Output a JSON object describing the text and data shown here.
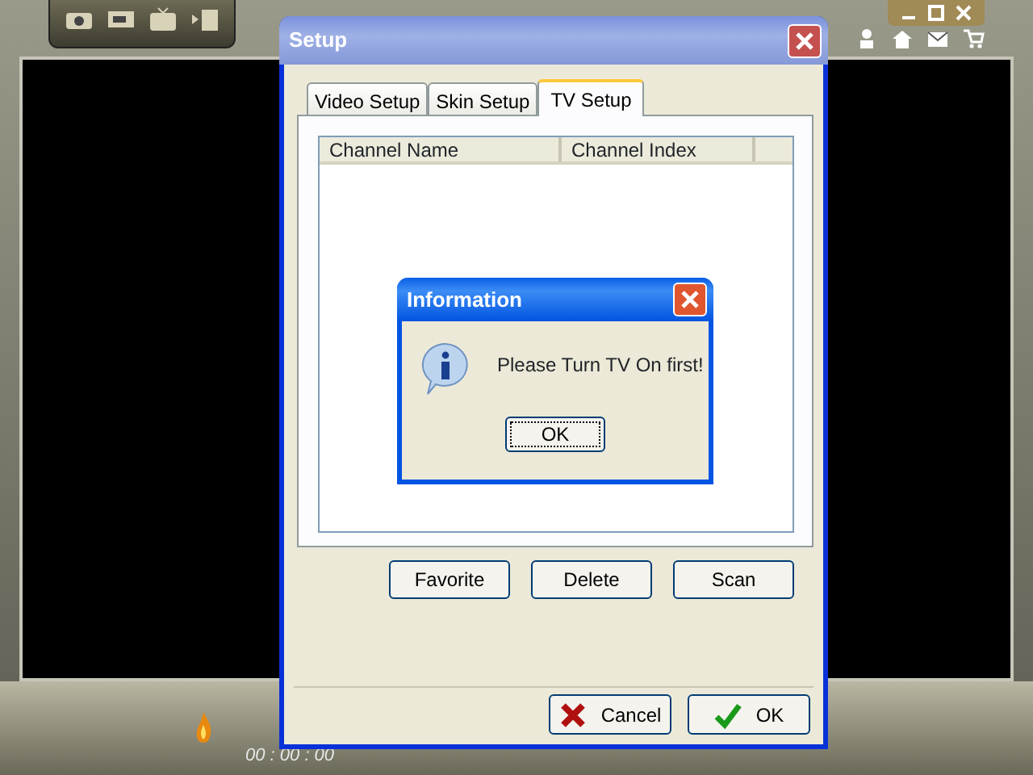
{
  "player": {
    "time": "00 : 00 : 00"
  },
  "setup_dialog": {
    "title": "Setup",
    "tabs": [
      {
        "label": "Video Setup",
        "selected": false
      },
      {
        "label": "Skin Setup",
        "selected": false
      },
      {
        "label": "TV Setup",
        "selected": true
      }
    ],
    "table": {
      "columns": [
        "Channel Name",
        "Channel Index"
      ]
    },
    "buttons": [
      "Favorite",
      "Delete",
      "Scan"
    ],
    "footer_buttons": [
      {
        "kind": "cancel",
        "label": "Cancel"
      },
      {
        "kind": "ok",
        "label": "OK"
      }
    ]
  },
  "info_dialog": {
    "title": "Information",
    "message": "Please Turn TV On first!",
    "button": "OK"
  }
}
